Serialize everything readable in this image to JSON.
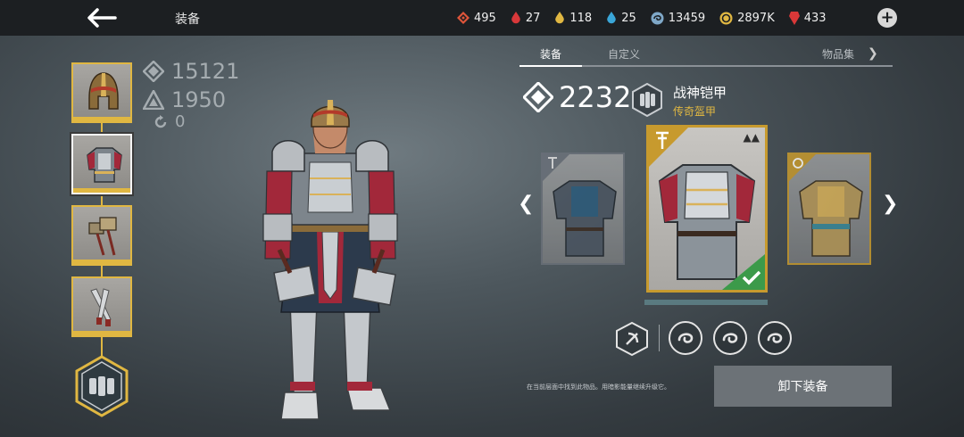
{
  "header": {
    "title": "装备",
    "back_icon": "back-arrow-icon",
    "currencies": [
      {
        "icon": "gem-red-diamond-icon",
        "value": "495",
        "color": "#e0553a"
      },
      {
        "icon": "red-drop-icon",
        "value": "27",
        "color": "#d8383a"
      },
      {
        "icon": "gold-drop-icon",
        "value": "118",
        "color": "#e0b742"
      },
      {
        "icon": "blue-drop-icon",
        "value": "25",
        "color": "#3aa6d8"
      },
      {
        "icon": "swirl-coin-icon",
        "value": "13459",
        "color": "#7fa8c8"
      },
      {
        "icon": "gold-coin-icon",
        "value": "2897K",
        "color": "#e0b742"
      },
      {
        "icon": "ruby-icon",
        "value": "433",
        "color": "#d83838"
      }
    ],
    "add_icon": "plus-circle-icon"
  },
  "slots": [
    {
      "name": "helmet",
      "icon": "helmet-icon"
    },
    {
      "name": "armor",
      "icon": "armor-icon"
    },
    {
      "name": "hammers",
      "icon": "hammer-icon"
    },
    {
      "name": "daggers",
      "icon": "dagger-icon"
    },
    {
      "name": "set-emblem",
      "icon": "armor-set-hex-icon"
    }
  ],
  "stats": {
    "power": "15121",
    "defense": "1950",
    "rebirth": "0"
  },
  "panel": {
    "tabs": [
      "装备",
      "自定义",
      "物品集"
    ],
    "power": "2232",
    "item_name": "战神铠甲",
    "item_rarity": "传奇盔甲",
    "hint": "在当前层面中找到此物品。用暗影能量继续升级它。",
    "unequip_label": "卸下装备"
  },
  "colors": {
    "accent_gold": "#e0b742",
    "legendary": "#c79a2e",
    "button": "#6c7277"
  }
}
